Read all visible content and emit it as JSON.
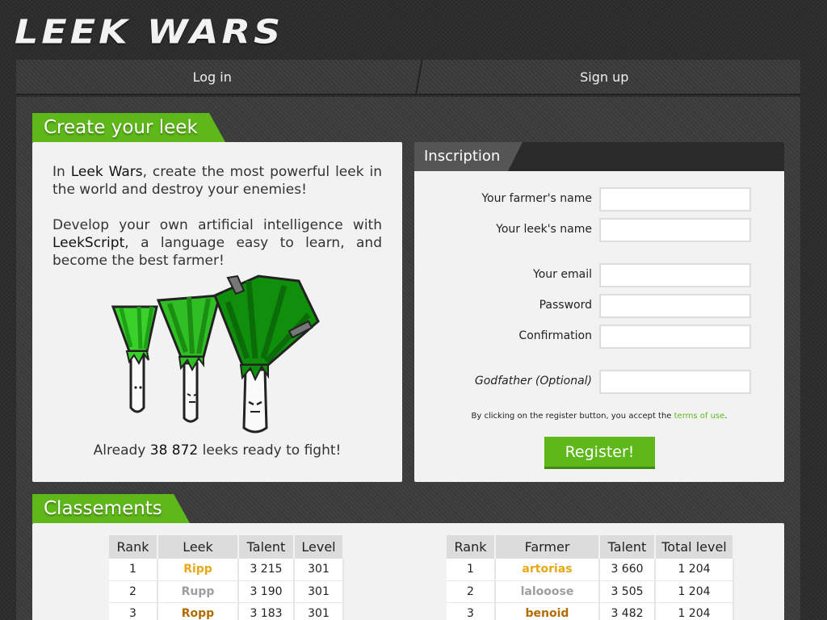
{
  "logo": "Leek Wars",
  "nav": {
    "login": "Log in",
    "signup": "Sign up"
  },
  "create": {
    "title": "Create your leek",
    "p1_pre": "In ",
    "p1_brand": "Leek Wars",
    "p1_post": ", create the most powerful leek in the world and destroy your enemies!",
    "p2_pre": "Develop your own artificial intelligence with ",
    "p2_lang": "LeekScript",
    "p2_post": ", a language easy to learn, and become the best farmer!",
    "already_pre": "Already ",
    "already_count": "38 872",
    "already_post": " leeks ready to fight!"
  },
  "inscription": {
    "tab": "Inscription",
    "fields": [
      {
        "label": "Your farmer's name",
        "value": ""
      },
      {
        "label": "Your leek's name",
        "value": ""
      },
      {
        "label": "Your email",
        "value": ""
      },
      {
        "label": "Password",
        "value": ""
      },
      {
        "label": "Confirmation",
        "value": ""
      },
      {
        "label": "Godfather (Optional)",
        "value": ""
      }
    ],
    "terms_pre": "By clicking on the register button, you accept the ",
    "terms_link": "terms of use",
    "terms_post": ".",
    "register": "Register!"
  },
  "rankings": {
    "title": "Classements",
    "leeks": {
      "headers": [
        "Rank",
        "Leek",
        "Talent",
        "Level"
      ],
      "rows": [
        {
          "rank": "1",
          "name": "Ripp",
          "talent": "3 215",
          "level": "301",
          "color": "#e6a817"
        },
        {
          "rank": "2",
          "name": "Rupp",
          "talent": "3 190",
          "level": "301",
          "color": "#9e9e9e"
        },
        {
          "rank": "3",
          "name": "Ropp",
          "talent": "3 183",
          "level": "301",
          "color": "#b36b00"
        }
      ]
    },
    "farmers": {
      "headers": [
        "Rank",
        "Farmer",
        "Talent",
        "Total level"
      ],
      "rows": [
        {
          "rank": "1",
          "name": "artorias",
          "talent": "3 660",
          "level": "1 204",
          "color": "#e6a817"
        },
        {
          "rank": "2",
          "name": "lalooose",
          "talent": "3 505",
          "level": "1 204",
          "color": "#9e9e9e"
        },
        {
          "rank": "3",
          "name": "benoid",
          "talent": "3 482",
          "level": "1 204",
          "color": "#b36b00"
        }
      ]
    }
  },
  "colors": {
    "accent": "#5fb81a",
    "gold": "#e6a817",
    "silver": "#9e9e9e",
    "bronze": "#b36b00"
  }
}
